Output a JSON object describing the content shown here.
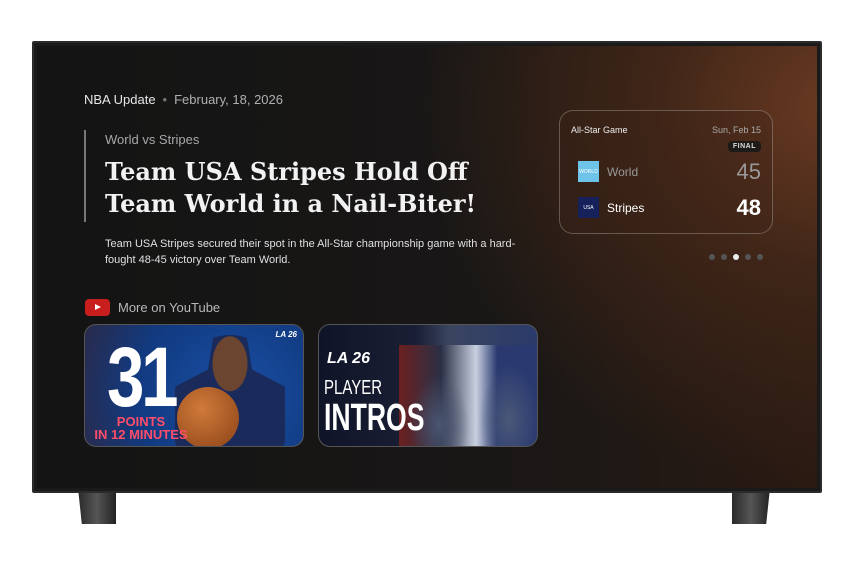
{
  "header": {
    "category": "NBA Update",
    "separator": "•",
    "date": "February, 18, 2026"
  },
  "article": {
    "subtitle": "World vs Stripes",
    "title": "Team USA Stripes Hold Off Team World in a Nail-Biter!",
    "description": "Team USA Stripes secured their spot in the All-Star championship game with a hard-fought 48-45 victory over Team World."
  },
  "youtube": {
    "label": "More on YouTube",
    "icon": "youtube-icon",
    "videos": [
      {
        "big_number": "31",
        "caption_line1": "POINTS",
        "caption_line2": "IN 12 MINUTES",
        "logo": "LA 26"
      },
      {
        "logo": "LA 26",
        "line1": "PLAYER",
        "line2": "INTROS"
      }
    ]
  },
  "scorecard": {
    "label": "All-Star Game",
    "date": "Sun, Feb 15",
    "status": "FINAL",
    "teams": [
      {
        "name": "World",
        "logo_text": "WORLD",
        "score": "45",
        "color": "#6ec3e8"
      },
      {
        "name": "Stripes",
        "logo_text": "USA",
        "score": "48",
        "color": "#16205a"
      }
    ]
  },
  "carousel": {
    "count": 5,
    "active_index": 2
  }
}
